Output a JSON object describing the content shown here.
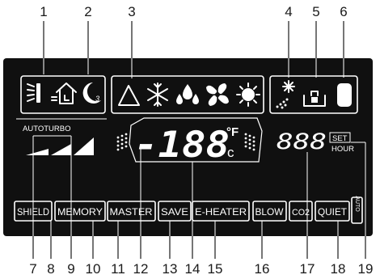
{
  "callouts": {
    "top": [
      "1",
      "2",
      "3",
      "4",
      "5",
      "6"
    ],
    "bottom": [
      "7",
      "8",
      "9",
      "10",
      "11",
      "12",
      "13",
      "14",
      "15",
      "16",
      "17",
      "18",
      "19"
    ]
  },
  "display": {
    "autoturbo_label": "AUTOTURBO",
    "temp_digits": "-188",
    "unit_f": "°F",
    "unit_c": "c",
    "timer_digits": "888",
    "set_label": "SET",
    "hour_label": "HOUR",
    "buttons": [
      "SHIELD",
      "MEMORY",
      "MASTER",
      "SAVE",
      "E-HEATER",
      "BLOW",
      "CO2",
      "QUIET"
    ],
    "auto_vertical": "AUTO"
  },
  "colors": {
    "panel": "#101010",
    "segment": "#ffffff",
    "callout_text": "#1a1a1a"
  },
  "icons": [
    "swing-icon",
    "home-icon",
    "sleep-icon",
    "auto-mode-icon",
    "cool-mode-icon",
    "dry-mode-icon",
    "fan-mode-icon",
    "heat-mode-icon",
    "clean-icon",
    "lock-icon",
    "battery-icon"
  ]
}
